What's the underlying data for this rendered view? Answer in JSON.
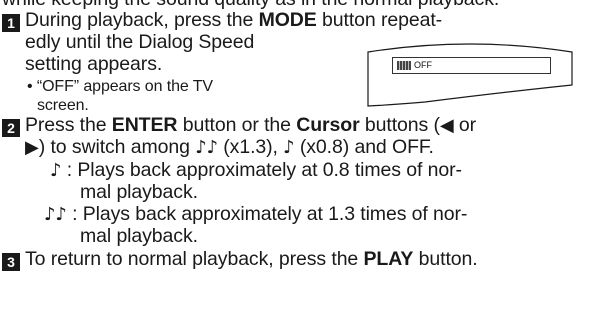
{
  "intro_fragment": "while keeping the sound quality as in the normal playback.",
  "step1": {
    "number": "1",
    "line1_pre": "During playback, press the ",
    "mode_button": "MODE",
    "line1_post": " button repeat-",
    "line2": "edly until the Dialog Speed",
    "line3": "setting appears.",
    "note_line1": "• “OFF” appears on the TV",
    "note_line2": "screen."
  },
  "tv_screen": {
    "osd_text": "OFF"
  },
  "step2": {
    "number": "2",
    "pre": "Press the ",
    "enter_button": "ENTER",
    "mid": " button or the ",
    "cursor_buttons": "Cursor",
    "post": " buttons (",
    "left_arrow": "◀",
    "or": " or",
    "right_arrow": "▶",
    "line2_text": ") to switch among ",
    "fast_symbol": "♪♪",
    "fast_label": " (x1.3), ",
    "slow_symbol": "♪",
    "slow_label": " (x0.8) and OFF.",
    "slow_desc_symbol": "♪",
    "slow_desc_1": " :  Plays back approximately at 0.8 times of nor-",
    "slow_desc_2": "mal playback.",
    "fast_desc_symbol": "♪♪",
    "fast_desc_1": " :  Plays back approximately at 1.3 times of nor-",
    "fast_desc_2": "mal playback."
  },
  "step3": {
    "number": "3",
    "pre": "To return to normal playback, press the ",
    "play_button": "PLAY",
    "post": " button."
  }
}
